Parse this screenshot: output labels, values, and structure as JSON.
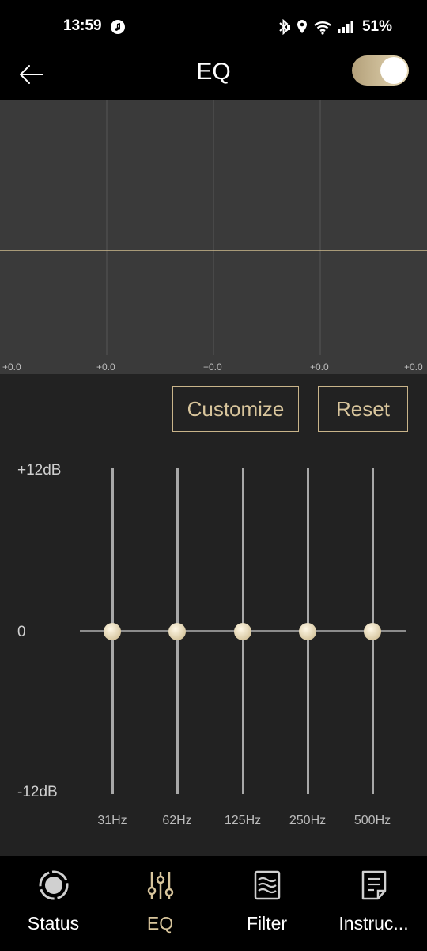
{
  "status_bar": {
    "time": "13:59",
    "battery": "51%"
  },
  "header": {
    "title": "EQ",
    "back_icon": "arrow-left-icon",
    "toggle_on": true
  },
  "curve": {
    "gains": [
      "+0.0",
      "+0.0",
      "+0.0",
      "+0.0",
      "+0.0"
    ]
  },
  "actions": {
    "customize_label": "Customize",
    "reset_label": "Reset"
  },
  "scale": {
    "max_label": "+12dB",
    "zero_label": "0",
    "min_label": "-12dB",
    "min_db": -12,
    "max_db": 12
  },
  "bands": [
    {
      "label": "31Hz",
      "gain_db": 0
    },
    {
      "label": "62Hz",
      "gain_db": 0
    },
    {
      "label": "125Hz",
      "gain_db": 0
    },
    {
      "label": "250Hz",
      "gain_db": 0
    },
    {
      "label": "500Hz",
      "gain_db": 0
    }
  ],
  "bottom_nav": [
    {
      "label": "Status",
      "icon": "record-circle-icon",
      "active": false
    },
    {
      "label": "EQ",
      "icon": "equalizer-sliders-icon",
      "active": true
    },
    {
      "label": "Filter",
      "icon": "waves-filter-icon",
      "active": false
    },
    {
      "label": "Instruc...",
      "icon": "document-icon",
      "active": false
    }
  ],
  "colors": {
    "accent": "#d8c59c",
    "background": "#222222",
    "curve_panel": "#3a3a3a"
  }
}
